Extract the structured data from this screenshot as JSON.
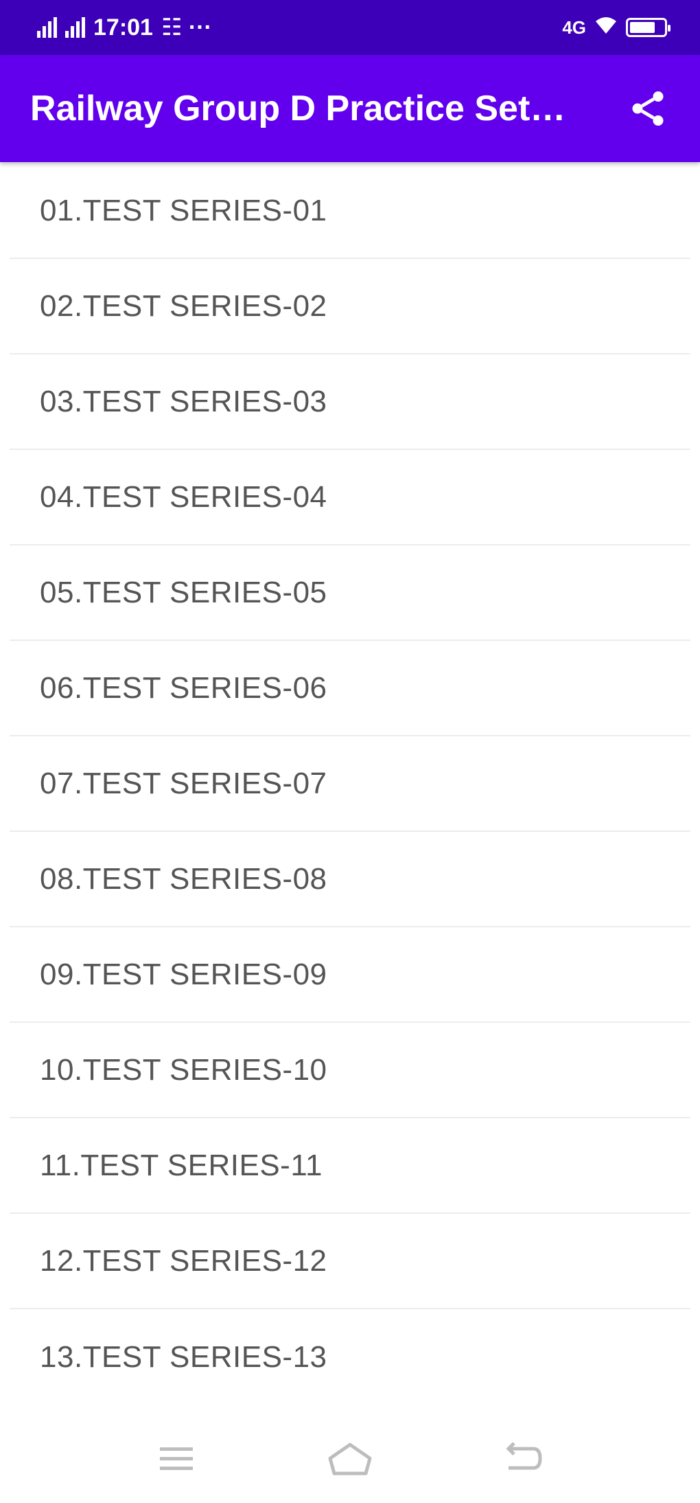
{
  "status_bar": {
    "time": "17:01",
    "notification_icons": "☷ ···",
    "network_label": "4G"
  },
  "app_bar": {
    "title": "Railway Group D Practice Set…",
    "share_icon": "share-icon"
  },
  "list": {
    "items": [
      "01.TEST SERIES-01",
      "02.TEST SERIES-02",
      "03.TEST SERIES-03",
      "04.TEST SERIES-04",
      "05.TEST SERIES-05",
      "06.TEST SERIES-06",
      "07.TEST SERIES-07",
      "08.TEST SERIES-08",
      "09.TEST SERIES-09",
      "10.TEST SERIES-10",
      "11.TEST SERIES-11",
      "12.TEST SERIES-12",
      "13.TEST SERIES-13"
    ]
  },
  "nav_bar": {
    "icons": [
      "menu-icon",
      "home-icon",
      "back-icon"
    ]
  },
  "colors": {
    "status_bar": "#3d00b8",
    "app_bar": "#6200ee",
    "item_text": "#555555",
    "divider": "#ececec"
  }
}
